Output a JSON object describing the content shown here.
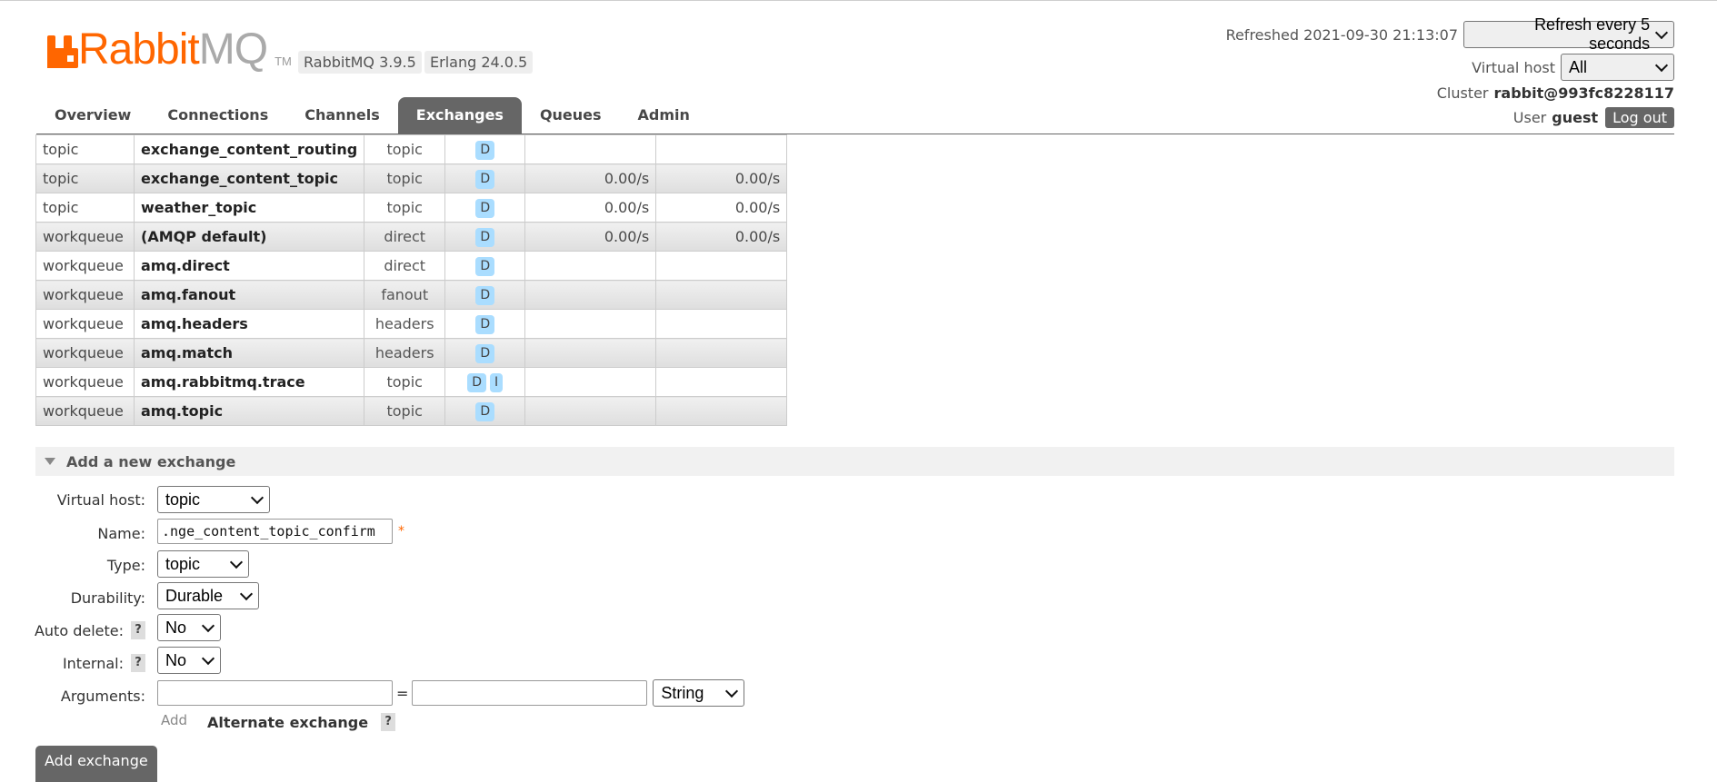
{
  "brand": {
    "word1": "Rabbit",
    "word2": "MQ",
    "tm": "TM"
  },
  "versions": {
    "rabbitmq": "RabbitMQ 3.9.5",
    "erlang": "Erlang 24.0.5"
  },
  "header": {
    "refreshed_label": "Refreshed 2021-09-30 21:13:07",
    "refresh_select": "Refresh every 5 seconds",
    "vhost_label": "Virtual host",
    "vhost_select": "All",
    "cluster_label": "Cluster",
    "cluster_value": "rabbit@993fc8228117",
    "user_label": "User",
    "user_value": "guest",
    "logout": "Log out"
  },
  "tabs": [
    {
      "label": "Overview",
      "active": false
    },
    {
      "label": "Connections",
      "active": false
    },
    {
      "label": "Channels",
      "active": false
    },
    {
      "label": "Exchanges",
      "active": true
    },
    {
      "label": "Queues",
      "active": false
    },
    {
      "label": "Admin",
      "active": false
    }
  ],
  "exchanges": [
    {
      "vhost": "topic",
      "name": "exchange_content_routing",
      "type": "topic",
      "features": [
        "D"
      ],
      "rate_in": "",
      "rate_out": ""
    },
    {
      "vhost": "topic",
      "name": "exchange_content_topic",
      "type": "topic",
      "features": [
        "D"
      ],
      "rate_in": "0.00/s",
      "rate_out": "0.00/s"
    },
    {
      "vhost": "topic",
      "name": "weather_topic",
      "type": "topic",
      "features": [
        "D"
      ],
      "rate_in": "0.00/s",
      "rate_out": "0.00/s"
    },
    {
      "vhost": "workqueue",
      "name": "(AMQP default)",
      "type": "direct",
      "features": [
        "D"
      ],
      "rate_in": "0.00/s",
      "rate_out": "0.00/s"
    },
    {
      "vhost": "workqueue",
      "name": "amq.direct",
      "type": "direct",
      "features": [
        "D"
      ],
      "rate_in": "",
      "rate_out": ""
    },
    {
      "vhost": "workqueue",
      "name": "amq.fanout",
      "type": "fanout",
      "features": [
        "D"
      ],
      "rate_in": "",
      "rate_out": ""
    },
    {
      "vhost": "workqueue",
      "name": "amq.headers",
      "type": "headers",
      "features": [
        "D"
      ],
      "rate_in": "",
      "rate_out": ""
    },
    {
      "vhost": "workqueue",
      "name": "amq.match",
      "type": "headers",
      "features": [
        "D"
      ],
      "rate_in": "",
      "rate_out": ""
    },
    {
      "vhost": "workqueue",
      "name": "amq.rabbitmq.trace",
      "type": "topic",
      "features": [
        "D",
        "I"
      ],
      "rate_in": "",
      "rate_out": ""
    },
    {
      "vhost": "workqueue",
      "name": "amq.topic",
      "type": "topic",
      "features": [
        "D"
      ],
      "rate_in": "",
      "rate_out": ""
    }
  ],
  "add_section": {
    "title": "Add a new exchange",
    "labels": {
      "vhost": "Virtual host:",
      "name": "Name:",
      "type": "Type:",
      "durability": "Durability:",
      "auto_delete": "Auto delete:",
      "internal": "Internal:",
      "arguments": "Arguments:"
    },
    "values": {
      "vhost": "topic",
      "name": ".nge_content_topic_confirm",
      "type": "topic",
      "durability": "Durable",
      "auto_delete": "No",
      "internal": "No",
      "arg_type": "String"
    },
    "required_mark": "*",
    "help_mark": "?",
    "equals": "=",
    "add_link": "Add",
    "alternate_exchange": "Alternate exchange",
    "submit": "Add exchange"
  }
}
